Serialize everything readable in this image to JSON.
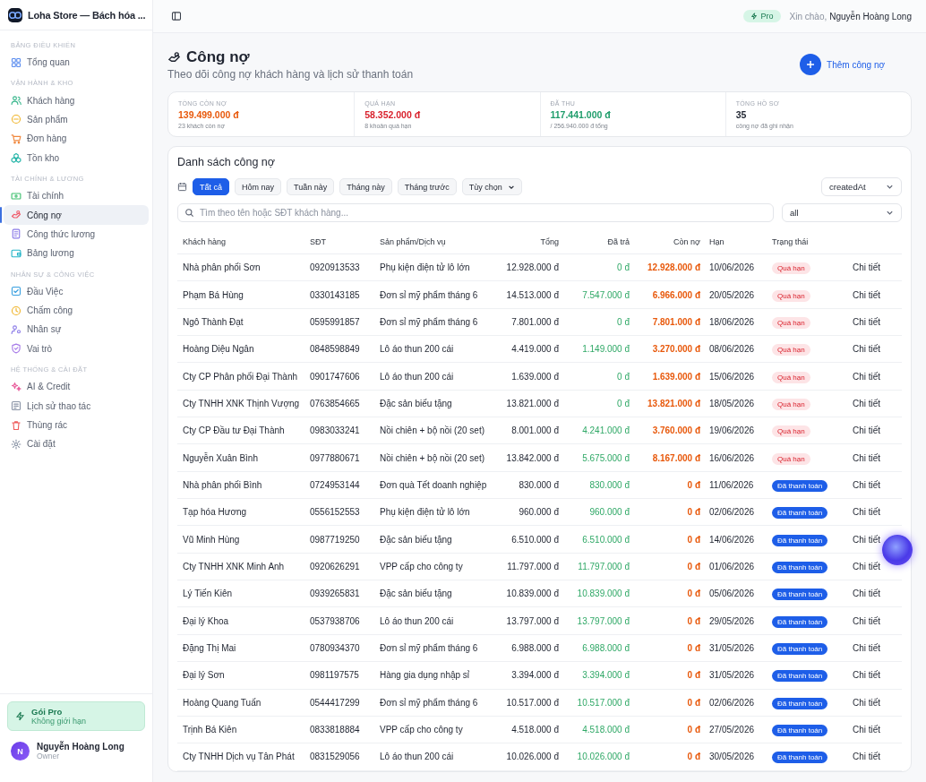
{
  "app": {
    "name": "Loha Store — Bách hóa ..."
  },
  "sidebar": {
    "sections": [
      {
        "title": "BẢNG ĐIỀU KHIỂN",
        "items": [
          {
            "label": "Tổng quan",
            "selected": false
          }
        ]
      },
      {
        "title": "VẬN HÀNH & KHO",
        "items": [
          {
            "label": "Khách hàng",
            "selected": false
          },
          {
            "label": "Sản phẩm",
            "selected": false
          },
          {
            "label": "Đơn hàng",
            "selected": false
          },
          {
            "label": "Tồn kho",
            "selected": false
          }
        ]
      },
      {
        "title": "TÀI CHÍNH & LƯƠNG",
        "items": [
          {
            "label": "Tài chính",
            "selected": false
          },
          {
            "label": "Công nợ",
            "selected": true
          },
          {
            "label": "Công thức lương",
            "selected": false
          },
          {
            "label": "Bảng lương",
            "selected": false
          }
        ]
      },
      {
        "title": "NHÂN SỰ & CÔNG VIỆC",
        "items": [
          {
            "label": "Đầu Việc",
            "selected": false
          },
          {
            "label": "Chấm công",
            "selected": false
          },
          {
            "label": "Nhân sự",
            "selected": false
          },
          {
            "label": "Vai trò",
            "selected": false
          }
        ]
      },
      {
        "title": "HỆ THỐNG & CÀI ĐẶT",
        "items": [
          {
            "label": "AI & Credit",
            "selected": false
          },
          {
            "label": "Lịch sử thao tác",
            "selected": false
          },
          {
            "label": "Thùng rác",
            "selected": false
          },
          {
            "label": "Cài đặt",
            "selected": false
          }
        ]
      }
    ],
    "plan": {
      "title": "Gói Pro",
      "subtitle": "Không giới hạn"
    },
    "user": {
      "initial": "N",
      "name": "Nguyễn Hoàng Long",
      "role": "Owner"
    }
  },
  "topbar": {
    "badge": "Pro",
    "greeting": "Xin chào,",
    "user": "Nguyễn Hoàng Long"
  },
  "page": {
    "title": "Công nợ",
    "subtitle": "Theo dõi công nợ khách hàng và lịch sử thanh toán",
    "add_button": "Thêm công nợ"
  },
  "stats": [
    {
      "label": "TỔNG CÒN NỢ",
      "value": "139.499.000 đ",
      "note": "23 khách còn nợ",
      "kind": "remaining"
    },
    {
      "label": "QUÁ HẠN",
      "value": "58.352.000 đ",
      "note": "8 khoản quá hạn",
      "kind": "overdue"
    },
    {
      "label": "ĐÃ THU",
      "value": "117.441.000 đ",
      "note": "/ 256.940.000 đ tổng",
      "kind": "paid"
    },
    {
      "label": "TỔNG HỒ SƠ",
      "value": "35",
      "note": "công nợ đã ghi nhận",
      "kind": "count"
    }
  ],
  "list": {
    "title": "Danh sách công nợ",
    "filters": [
      {
        "label": "Tất cả",
        "selected": true
      },
      {
        "label": "Hôm nay",
        "selected": false
      },
      {
        "label": "Tuần này",
        "selected": false
      },
      {
        "label": "Tháng này",
        "selected": false
      },
      {
        "label": "Tháng trước",
        "selected": false
      },
      {
        "label": "Tùy chọn",
        "selected": false
      }
    ],
    "sort": "createdAt",
    "search": {
      "placeholder": "Tìm theo tên hoặc SĐT khách hàng..."
    },
    "status_filter": "all",
    "columns": [
      "Khách hàng",
      "SĐT",
      "Sản phẩm/Dịch vụ",
      "Tổng",
      "Đã trả",
      "Còn nợ",
      "Hạn",
      "Trạng thái"
    ],
    "rows": [
      {
        "customer": "Nhà phân phối Sơn",
        "phone": "0920913533",
        "product": "Phụ kiện điện tử lô lớn",
        "total": "12.928.000 đ",
        "paid": "0 đ",
        "remaining": "12.928.000 đ",
        "due": "10/06/2026",
        "status": {
          "label": "Quá hạn",
          "kind": "overdue"
        },
        "action": "Chi tiết"
      },
      {
        "customer": "Phạm Bá Hùng",
        "phone": "0330143185",
        "product": "Đơn sỉ mỹ phẩm tháng 6",
        "total": "14.513.000 đ",
        "paid": "7.547.000 đ",
        "remaining": "6.966.000 đ",
        "due": "20/05/2026",
        "status": {
          "label": "Quá hạn",
          "kind": "overdue"
        },
        "action": "Chi tiết"
      },
      {
        "customer": "Ngô Thành Đạt",
        "phone": "0595991857",
        "product": "Đơn sỉ mỹ phẩm tháng 6",
        "total": "7.801.000 đ",
        "paid": "0 đ",
        "remaining": "7.801.000 đ",
        "due": "18/06/2026",
        "status": {
          "label": "Quá hạn",
          "kind": "overdue"
        },
        "action": "Chi tiết"
      },
      {
        "customer": "Hoàng Diệu Ngân",
        "phone": "0848598849",
        "product": "Lô áo thun 200 cái",
        "total": "4.419.000 đ",
        "paid": "1.149.000 đ",
        "remaining": "3.270.000 đ",
        "due": "08/06/2026",
        "status": {
          "label": "Quá hạn",
          "kind": "overdue"
        },
        "action": "Chi tiết"
      },
      {
        "customer": "Cty CP Phân phối Đại Thành",
        "phone": "0901747606",
        "product": "Lô áo thun 200 cái",
        "total": "1.639.000 đ",
        "paid": "0 đ",
        "remaining": "1.639.000 đ",
        "due": "15/06/2026",
        "status": {
          "label": "Quá hạn",
          "kind": "overdue"
        },
        "action": "Chi tiết"
      },
      {
        "customer": "Cty TNHH XNK Thịnh Vượng",
        "phone": "0763854665",
        "product": "Đặc sản biếu tặng",
        "total": "13.821.000 đ",
        "paid": "0 đ",
        "remaining": "13.821.000 đ",
        "due": "18/05/2026",
        "status": {
          "label": "Quá hạn",
          "kind": "overdue"
        },
        "action": "Chi tiết"
      },
      {
        "customer": "Cty CP Đầu tư Đại Thành",
        "phone": "0983033241",
        "product": "Nồi chiên + bộ nồi (20 set)",
        "total": "8.001.000 đ",
        "paid": "4.241.000 đ",
        "remaining": "3.760.000 đ",
        "due": "19/06/2026",
        "status": {
          "label": "Quá hạn",
          "kind": "overdue"
        },
        "action": "Chi tiết"
      },
      {
        "customer": "Nguyễn Xuân Bình",
        "phone": "0977880671",
        "product": "Nồi chiên + bộ nồi (20 set)",
        "total": "13.842.000 đ",
        "paid": "5.675.000 đ",
        "remaining": "8.167.000 đ",
        "due": "16/06/2026",
        "status": {
          "label": "Quá hạn",
          "kind": "overdue"
        },
        "action": "Chi tiết"
      },
      {
        "customer": "Nhà phân phối Bình",
        "phone": "0724953144",
        "product": "Đơn quà Tết doanh nghiệp",
        "total": "830.000 đ",
        "paid": "830.000 đ",
        "remaining": "0 đ",
        "due": "11/06/2026",
        "status": {
          "label": "Đã thanh toán",
          "kind": "paid"
        },
        "action": "Chi tiết"
      },
      {
        "customer": "Tạp hóa Hương",
        "phone": "0556152553",
        "product": "Phụ kiện điện tử lô lớn",
        "total": "960.000 đ",
        "paid": "960.000 đ",
        "remaining": "0 đ",
        "due": "02/06/2026",
        "status": {
          "label": "Đã thanh toán",
          "kind": "paid"
        },
        "action": "Chi tiết"
      },
      {
        "customer": "Vũ Minh Hùng",
        "phone": "0987719250",
        "product": "Đặc sản biếu tặng",
        "total": "6.510.000 đ",
        "paid": "6.510.000 đ",
        "remaining": "0 đ",
        "due": "14/06/2026",
        "status": {
          "label": "Đã thanh toán",
          "kind": "paid"
        },
        "action": "Chi tiết"
      },
      {
        "customer": "Cty TNHH XNK Minh Anh",
        "phone": "0920626291",
        "product": "VPP cấp cho công ty",
        "total": "11.797.000 đ",
        "paid": "11.797.000 đ",
        "remaining": "0 đ",
        "due": "01/06/2026",
        "status": {
          "label": "Đã thanh toán",
          "kind": "paid"
        },
        "action": "Chi tiết"
      },
      {
        "customer": "Lý Tiến Kiên",
        "phone": "0939265831",
        "product": "Đặc sản biếu tặng",
        "total": "10.839.000 đ",
        "paid": "10.839.000 đ",
        "remaining": "0 đ",
        "due": "05/06/2026",
        "status": {
          "label": "Đã thanh toán",
          "kind": "paid"
        },
        "action": "Chi tiết"
      },
      {
        "customer": "Đại lý Khoa",
        "phone": "0537938706",
        "product": "Lô áo thun 200 cái",
        "total": "13.797.000 đ",
        "paid": "13.797.000 đ",
        "remaining": "0 đ",
        "due": "29/05/2026",
        "status": {
          "label": "Đã thanh toán",
          "kind": "paid"
        },
        "action": "Chi tiết"
      },
      {
        "customer": "Đặng Thị Mai",
        "phone": "0780934370",
        "product": "Đơn sỉ mỹ phẩm tháng 6",
        "total": "6.988.000 đ",
        "paid": "6.988.000 đ",
        "remaining": "0 đ",
        "due": "31/05/2026",
        "status": {
          "label": "Đã thanh toán",
          "kind": "paid"
        },
        "action": "Chi tiết"
      },
      {
        "customer": "Đại lý Sơn",
        "phone": "0981197575",
        "product": "Hàng gia dụng nhập sỉ",
        "total": "3.394.000 đ",
        "paid": "3.394.000 đ",
        "remaining": "0 đ",
        "due": "31/05/2026",
        "status": {
          "label": "Đã thanh toán",
          "kind": "paid"
        },
        "action": "Chi tiết"
      },
      {
        "customer": "Hoàng Quang Tuấn",
        "phone": "0544417299",
        "product": "Đơn sỉ mỹ phẩm tháng 6",
        "total": "10.517.000 đ",
        "paid": "10.517.000 đ",
        "remaining": "0 đ",
        "due": "02/06/2026",
        "status": {
          "label": "Đã thanh toán",
          "kind": "paid"
        },
        "action": "Chi tiết"
      },
      {
        "customer": "Trịnh Bá Kiên",
        "phone": "0833818884",
        "product": "VPP cấp cho công ty",
        "total": "4.518.000 đ",
        "paid": "4.518.000 đ",
        "remaining": "0 đ",
        "due": "27/05/2026",
        "status": {
          "label": "Đã thanh toán",
          "kind": "paid"
        },
        "action": "Chi tiết"
      },
      {
        "customer": "Cty TNHH Dịch vụ Tân Phát",
        "phone": "0831529056",
        "product": "Lô áo thun 200 cái",
        "total": "10.026.000 đ",
        "paid": "10.026.000 đ",
        "remaining": "0 đ",
        "due": "30/05/2026",
        "status": {
          "label": "Đã thanh toán",
          "kind": "paid"
        },
        "action": "Chi tiết"
      }
    ]
  }
}
